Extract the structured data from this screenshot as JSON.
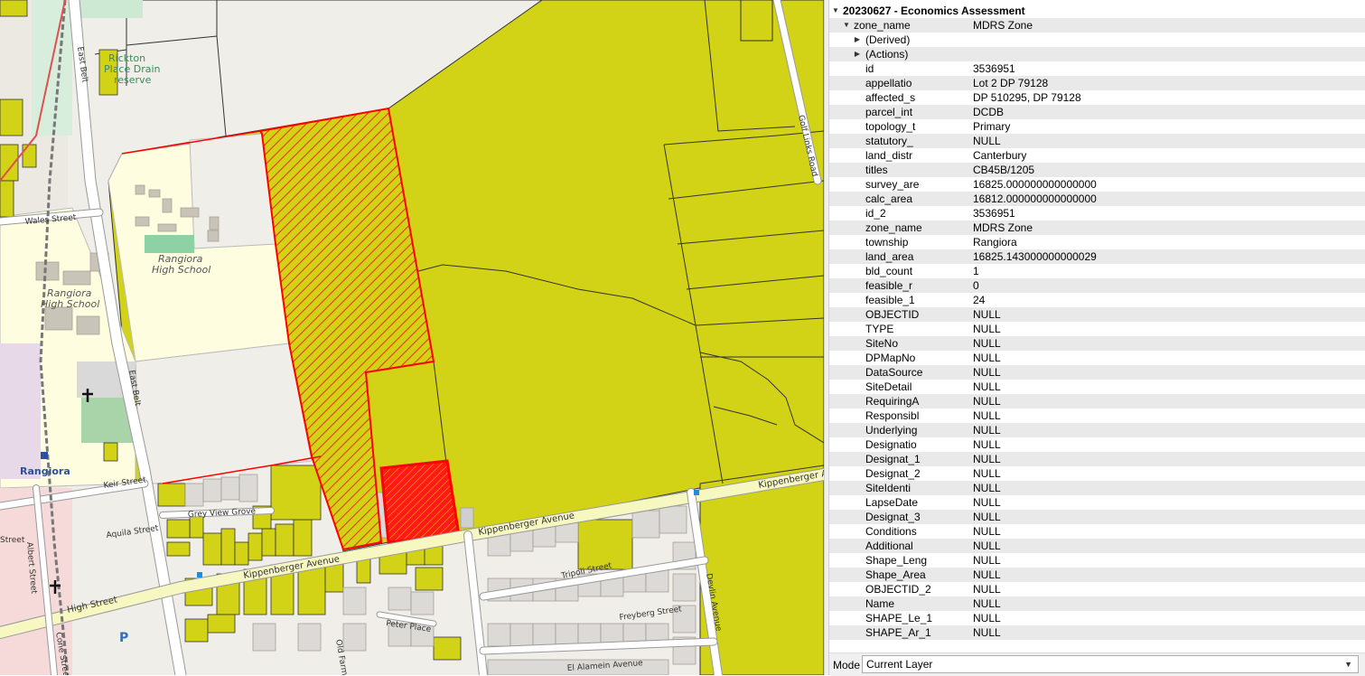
{
  "map": {
    "labels": {
      "ricton": "Rickton",
      "place_drain": "Place Drain",
      "reserve": "reserve",
      "east_belt_top": "East Belt",
      "golf_links_road": "Golf Links Road",
      "wales_street": "Wales Street",
      "rangiora_high_school_1": "Rangiora",
      "rangiora_high_school_2": "High School",
      "rangiora_high_school_3": "Rangiora",
      "rangiora_high_school_4": "High School",
      "east_belt_lower": "East Belt",
      "rangiora": "Rangiora",
      "keir_street": "Keir Street",
      "grey_view_grove": "Grey View Grove",
      "aquila_street": "Aquila Street",
      "kippenberger_avenue_1": "Kippenberger Avenue",
      "kippenberger_avenue_2": "Kippenberger Avenue",
      "kippenberger_avenue_3": "Kippenberger A",
      "high_street": "High Street",
      "albert_street": "Albert Street",
      "street": "Street",
      "tripoli_street": "Tripoli Street",
      "devlin_avenue": "Devlin Avenue",
      "freyberg_street": "Freyberg Street",
      "peter_place": "Peter Place",
      "old_farm": "Old Farm",
      "el_alamein_avenue": "El Alamein Avenue",
      "cone_street": "Cone Street",
      "parking": "P"
    },
    "colors": {
      "parcel_fill": "#d2d216",
      "selected": "#ff0000",
      "school": "#fefde0",
      "road": "#ffffff",
      "base": "#f0eee8"
    }
  },
  "identify": {
    "layer_title": "20230627 - Economics Assessment",
    "feature_field": "zone_name",
    "feature_value": "MDRS Zone",
    "derived": "(Derived)",
    "actions": "(Actions)",
    "attributes": [
      {
        "name": "id",
        "value": "3536951"
      },
      {
        "name": "appellatio",
        "value": "Lot 2 DP 79128"
      },
      {
        "name": "affected_s",
        "value": "DP 510295, DP 79128"
      },
      {
        "name": "parcel_int",
        "value": "DCDB"
      },
      {
        "name": "topology_t",
        "value": "Primary"
      },
      {
        "name": "statutory_",
        "value": "NULL"
      },
      {
        "name": "land_distr",
        "value": "Canterbury"
      },
      {
        "name": "titles",
        "value": "CB45B/1205"
      },
      {
        "name": "survey_are",
        "value": "16825.000000000000000"
      },
      {
        "name": "calc_area",
        "value": "16812.000000000000000"
      },
      {
        "name": "id_2",
        "value": "3536951"
      },
      {
        "name": "zone_name",
        "value": "MDRS Zone"
      },
      {
        "name": "township",
        "value": "Rangiora"
      },
      {
        "name": "land_area",
        "value": "16825.143000000000029"
      },
      {
        "name": "bld_count",
        "value": "1"
      },
      {
        "name": "feasible_r",
        "value": "0"
      },
      {
        "name": "feasible_1",
        "value": "24"
      },
      {
        "name": "OBJECTID",
        "value": "NULL"
      },
      {
        "name": "TYPE",
        "value": "NULL"
      },
      {
        "name": "SiteNo",
        "value": "NULL"
      },
      {
        "name": "DPMapNo",
        "value": "NULL"
      },
      {
        "name": "DataSource",
        "value": "NULL"
      },
      {
        "name": "SiteDetail",
        "value": "NULL"
      },
      {
        "name": "RequiringA",
        "value": "NULL"
      },
      {
        "name": "Responsibl",
        "value": "NULL"
      },
      {
        "name": "Underlying",
        "value": "NULL"
      },
      {
        "name": "Designatio",
        "value": "NULL"
      },
      {
        "name": "Designat_1",
        "value": "NULL"
      },
      {
        "name": "Designat_2",
        "value": "NULL"
      },
      {
        "name": "SiteIdenti",
        "value": "NULL"
      },
      {
        "name": "LapseDate",
        "value": "NULL"
      },
      {
        "name": "Designat_3",
        "value": "NULL"
      },
      {
        "name": "Conditions",
        "value": "NULL"
      },
      {
        "name": "Additional",
        "value": "NULL"
      },
      {
        "name": "Shape_Leng",
        "value": "NULL"
      },
      {
        "name": "Shape_Area",
        "value": "NULL"
      },
      {
        "name": "OBJECTID_2",
        "value": "NULL"
      },
      {
        "name": "Name",
        "value": "NULL"
      },
      {
        "name": "SHAPE_Le_1",
        "value": "NULL"
      },
      {
        "name": "SHAPE_Ar_1",
        "value": "NULL"
      }
    ],
    "mode_label": "Mode",
    "mode_value": "Current Layer"
  }
}
